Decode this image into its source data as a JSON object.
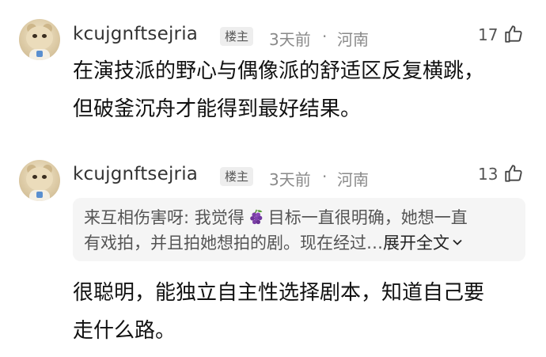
{
  "comments": [
    {
      "username": "kcujgnftsejria",
      "badge": "楼主",
      "time": "3天前",
      "separator": "·",
      "location": "河南",
      "likes": "17",
      "content_lines": [
        "在演技派的野心与偶像派的舒适区反复横跳，",
        "但破釜沉舟才能得到最好结果。"
      ]
    },
    {
      "username": "kcujgnftsejria",
      "badge": "楼主",
      "time": "3天前",
      "separator": "·",
      "location": "河南",
      "likes": "13",
      "quote": {
        "user": "来互相伤害呀:",
        "text_before_emoji": "我觉得",
        "emoji": "grape-emoji",
        "text_after_emoji_line1": "目标一直很明确，她想一直",
        "line2": "有戏拍，并且拍她想拍的剧。现在经过…",
        "expand_label": "展开全文"
      },
      "content_lines": [
        "很聪明，能独立自主性选择剧本，知道自己要",
        "走什么路。"
      ]
    }
  ],
  "icons": {
    "like": "thumbs-up-icon",
    "expand": "chevron-down-icon"
  },
  "colors": {
    "meta": "#8a8a8a",
    "quote_bg": "#f5f5f5",
    "badge_bg": "#eeeeee"
  }
}
